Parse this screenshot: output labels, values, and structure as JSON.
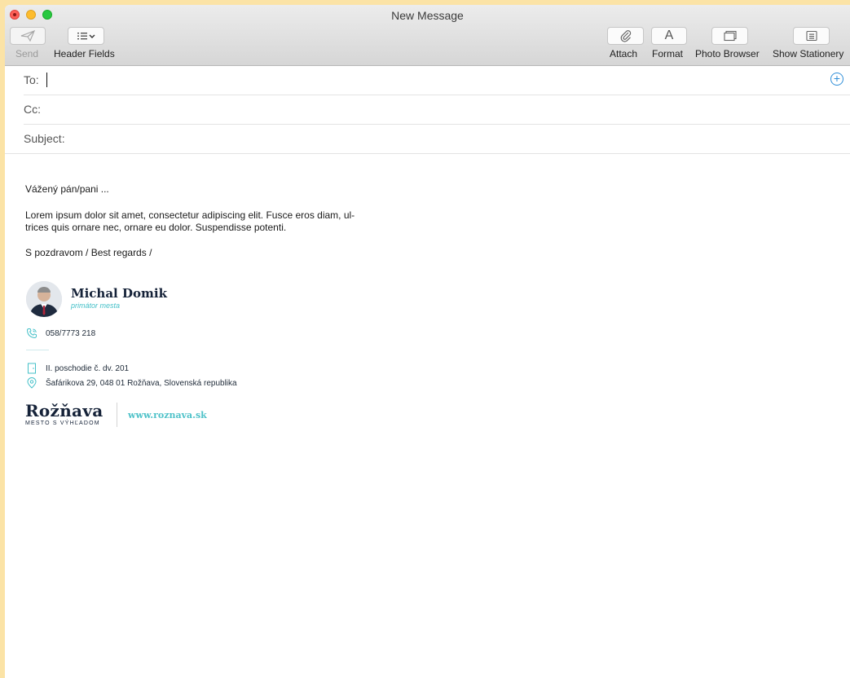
{
  "window": {
    "title": "New Message"
  },
  "toolbar": {
    "send": "Send",
    "header_fields": "Header Fields",
    "attach": "Attach",
    "format": "Format",
    "format_glyph": "A",
    "photo_browser": "Photo Browser",
    "show_stationery": "Show Stationery"
  },
  "fields": {
    "to": "To:",
    "cc": "Cc:",
    "subject": "Subject:"
  },
  "message": {
    "greeting": "Vážený pán/pani ...",
    "paragraph_line1": "Lorem ipsum dolor sit amet, consectetur adipiscing elit. Fusce eros diam, ul-",
    "paragraph_line2": "trices quis ornare nec, ornare eu dolor. Suspendisse potenti.",
    "closing": "S pozdravom / Best regards /"
  },
  "signature": {
    "name": "Michal Domik",
    "role": "primátor mesta",
    "phone": "058/7773 218",
    "office": "II. poschodie č. dv. 201",
    "address": "Šafárikova 29, 048 01 Rožňava, Slovenská republika",
    "logo_text": "Rožňava",
    "logo_tagline": "MESTO S VÝHĽADOM",
    "website": "www.roznava.sk"
  },
  "colors": {
    "accent": "#4fc2c9",
    "navy": "#152238",
    "link_blue": "#2f8ed8"
  }
}
